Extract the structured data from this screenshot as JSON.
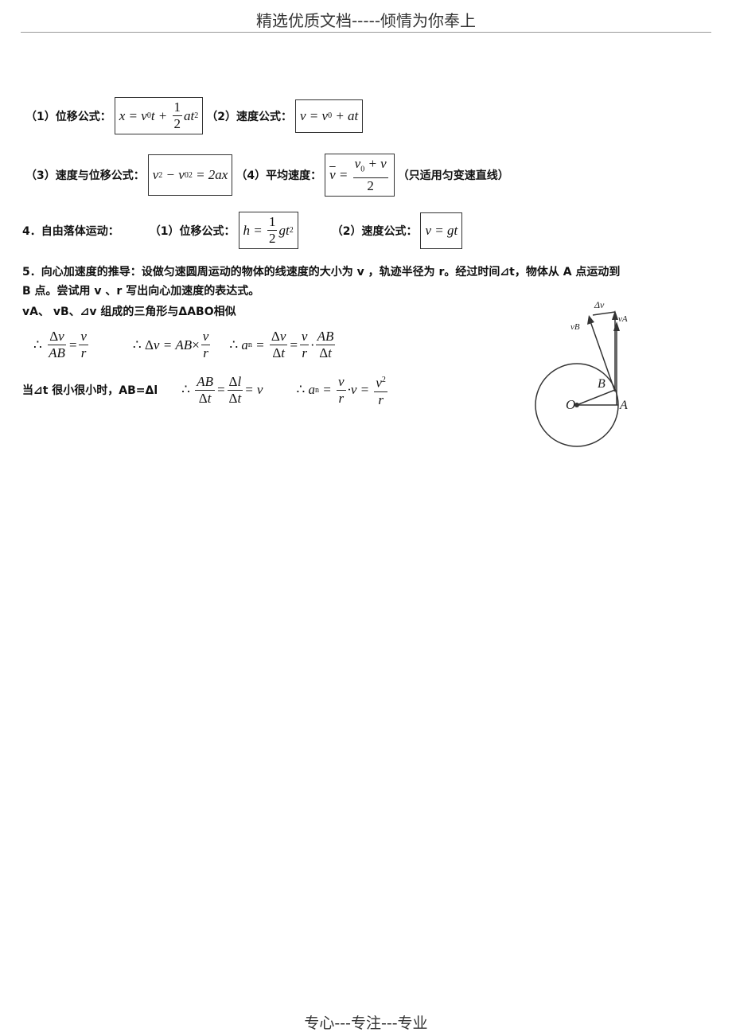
{
  "header": {
    "title": "精选优质文档-----倾情为你奉上"
  },
  "footer": {
    "text": "专心---专注---专业"
  },
  "formulas": {
    "f1_label": "（1）位移公式：",
    "f2_label": "（2）速度公式：",
    "f3_label": "（3）速度与位移公式：",
    "f4_label": "（4）平均速度：",
    "f4_note": "（只适用匀变速直线）"
  },
  "free_fall": {
    "title": "4．自由落体运动：",
    "f1_label": "（1）位移公式：",
    "f2_label": "（2）速度公式："
  },
  "centripetal": {
    "line1": "5．向心加速度的推导：设做匀速圆周运动的物体的线速度的大小为 v ，轨迹半径为 r。经过时间⊿t，物体从 A 点运动到",
    "line2": "B 点。尝试用 v 、r 写出向心加速度的表达式。",
    "line3": "vA、 vB、⊿v 组成的三角形与ΔABO相似",
    "line5_prefix": "当⊿t 很小很小时，AB=Δl"
  },
  "diagram": {
    "labels": {
      "center": "O",
      "point_a": "A",
      "point_b": "B",
      "delta_v": "Δv",
      "v_a": "vA",
      "v_b": "vB"
    }
  }
}
